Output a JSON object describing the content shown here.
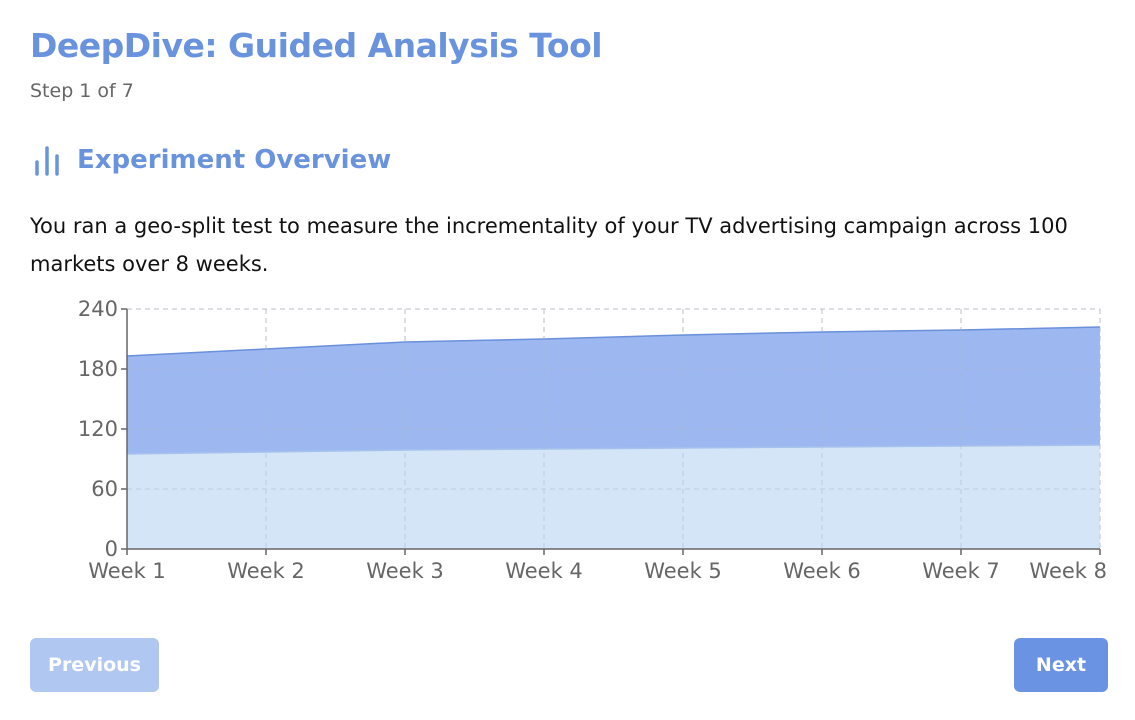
{
  "header": {
    "title": "DeepDive: Guided Analysis Tool",
    "step": "Step 1 of 7"
  },
  "section": {
    "icon": "bar-chart-icon",
    "title": "Experiment Overview",
    "description": "You ran a geo-split test to measure the incrementality of your TV advertising campaign across 100 markets over 8 weeks."
  },
  "colors": {
    "accent": "#6a93de",
    "upper_area": "#9db8f0",
    "upper_line": "#6a8fdc",
    "lower_area": "#d3e5f7",
    "lower_line": "#a6c2ec",
    "button_primary": "#6a93e4",
    "button_disabled": "#b0c7f1"
  },
  "chart_data": {
    "type": "area",
    "stacked": false,
    "categories": [
      "Week 1",
      "Week 2",
      "Week 3",
      "Week 4",
      "Week 5",
      "Week 6",
      "Week 7",
      "Week 8"
    ],
    "series": [
      {
        "values": [
          193,
          200,
          207,
          210,
          214,
          217,
          219,
          222
        ]
      },
      {
        "values": [
          95,
          97,
          99,
          100,
          101,
          102,
          103,
          104
        ]
      }
    ],
    "yticks": [
      0,
      60,
      120,
      180,
      240
    ],
    "ylim": [
      0,
      240
    ],
    "grid": true
  },
  "buttons": {
    "previous": "Previous",
    "next": "Next"
  }
}
